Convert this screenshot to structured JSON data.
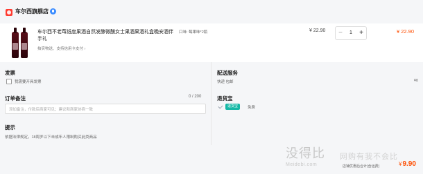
{
  "store": {
    "name": "车尔西旗舰店",
    "icon": "store-icon",
    "badge_icon": "verified-icon",
    "accent": "#ff3b30"
  },
  "product": {
    "title": "车尔西不老莓纸度果酒自然发酵微醺女士果酒果酒礼盒晚安酒伴手礼",
    "sub": "拍实物送、支持信用卡支付 ›",
    "spec": "口味: 莓果味*2瓶",
    "unit_price": "¥ 22.90",
    "quantity": "1",
    "minus_label": "−",
    "plus_label": "+",
    "total": "¥ 22.90"
  },
  "invoice": {
    "title": "发票",
    "option_label": "我需要开具发票"
  },
  "remark": {
    "title": "订单备注",
    "counter": "0 / 200",
    "placeholder": "添加备注，付款后商家可见；建议和商家协商一致"
  },
  "tips": {
    "title": "提示",
    "text": "依据法律规定，18周岁以下未成年人限制购买此类商品"
  },
  "delivery": {
    "title": "配送服务",
    "method": "快递 包邮",
    "price": "¥0"
  },
  "refund": {
    "title": "退货宝",
    "badge": "退货宝",
    "free": "免费"
  },
  "summary": {
    "label": "店铺优惠后合计(含运费)",
    "amount": "9.90",
    "yen": "¥"
  },
  "watermark": {
    "main": "没得比",
    "sub": "Meidebi.com",
    "right": "网购有我不会比"
  }
}
